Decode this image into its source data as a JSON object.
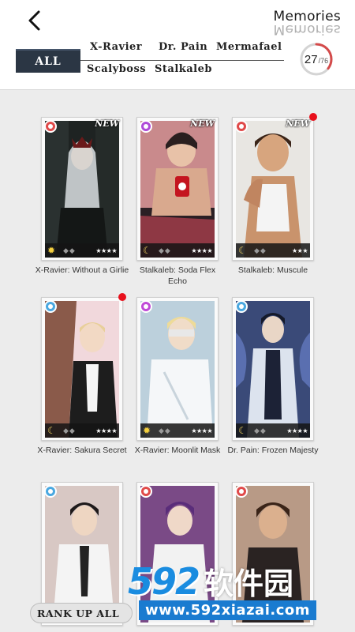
{
  "header": {
    "title": "Memories",
    "tabs": [
      "ALL",
      "X-Ravier",
      "Dr. Pain",
      "Mermafael",
      "Scalyboss",
      "Stalkaleb"
    ],
    "collected": "27",
    "total": "/76",
    "progress": 0.355
  },
  "cards": [
    {
      "caption": "X-Ravier: Without a Girlie",
      "new_label": "NEW",
      "badge_color": "#e04a4a",
      "phase": "sun",
      "stars": "★★★★",
      "has_new": true,
      "has_dot": false
    },
    {
      "caption": "Stalkaleb: Soda Flex Echo",
      "new_label": "NEW",
      "badge_color": "#b04ad8",
      "phase": "moon",
      "stars": "★★★★",
      "has_new": true,
      "has_dot": false
    },
    {
      "caption": "Stalkaleb: Muscule",
      "new_label": "NEW",
      "badge_color": "#e04a4a",
      "phase": "moon",
      "stars": "★★★",
      "has_new": true,
      "has_dot": true
    },
    {
      "caption": "X-Ravier: Sakura Secret",
      "badge_color": "#4aa8e0",
      "phase": "moon",
      "stars": "★★★★",
      "has_new": false,
      "has_dot": true
    },
    {
      "caption": "X-Ravier: Moonlit Mask",
      "badge_color": "#c04ad8",
      "phase": "sun",
      "stars": "★★★★",
      "has_new": false,
      "has_dot": false
    },
    {
      "caption": "Dr. Pain: Frozen Majesty",
      "badge_color": "#4aa8e0",
      "phase": "moon",
      "stars": "★★★★",
      "has_new": false,
      "has_dot": false
    },
    {
      "caption": "",
      "badge_color": "#4aa8e0",
      "phase": "",
      "stars": "",
      "has_new": false,
      "has_dot": false
    },
    {
      "caption": "",
      "badge_color": "#e04a4a",
      "phase": "",
      "stars": "",
      "has_new": false,
      "has_dot": false
    },
    {
      "caption": "",
      "badge_color": "#e04a4a",
      "phase": "",
      "stars": "",
      "has_new": false,
      "has_dot": false
    }
  ],
  "rank_up_label": "RANK UP ALL",
  "watermark": {
    "brand_number": "592",
    "brand_text": "软件园",
    "url": "www.592xiazai.com"
  },
  "icons": {
    "back": "chevron-left-icon",
    "sun_phase": "sun-icon",
    "moon_phase": "moon-icon",
    "gem": "gem-icon",
    "star": "star-icon"
  }
}
